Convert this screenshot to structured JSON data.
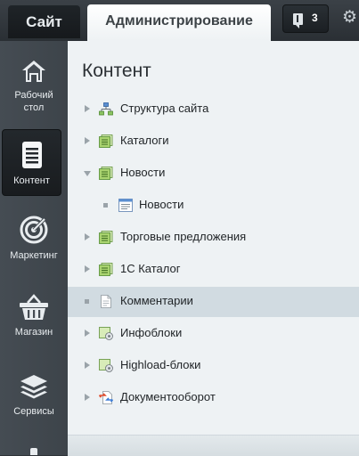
{
  "top": {
    "tab_site": "Сайт",
    "tab_admin": "Администрирование",
    "notifications_count": "3"
  },
  "sidebar": {
    "items": [
      {
        "label": "Рабочий стол",
        "icon": "home-icon"
      },
      {
        "label": "Контент",
        "icon": "document-icon"
      },
      {
        "label": "Маркетинг",
        "icon": "target-icon"
      },
      {
        "label": "Магазин",
        "icon": "basket-icon"
      },
      {
        "label": "Сервисы",
        "icon": "layers-icon"
      }
    ]
  },
  "content": {
    "title": "Контент",
    "tree": [
      {
        "label": "Структура сайта",
        "icon": "site-structure-icon",
        "state": "collapsed"
      },
      {
        "label": "Каталоги",
        "icon": "catalog-icon",
        "state": "collapsed"
      },
      {
        "label": "Новости",
        "icon": "news-icon",
        "state": "expanded"
      },
      {
        "label": "Новости",
        "icon": "news-list-icon",
        "state": "leaf"
      },
      {
        "label": "Торговые предложения",
        "icon": "catalog-icon",
        "state": "collapsed"
      },
      {
        "label": "1С Каталог",
        "icon": "catalog-icon",
        "state": "collapsed"
      },
      {
        "label": "Комментарии",
        "icon": "page-icon",
        "state": "selected"
      },
      {
        "label": "Инфоблоки",
        "icon": "infoblock-icon",
        "state": "collapsed"
      },
      {
        "label": "Highload-блоки",
        "icon": "infoblock-icon",
        "state": "collapsed"
      },
      {
        "label": "Документооборот",
        "icon": "workflow-icon",
        "state": "collapsed"
      }
    ]
  }
}
